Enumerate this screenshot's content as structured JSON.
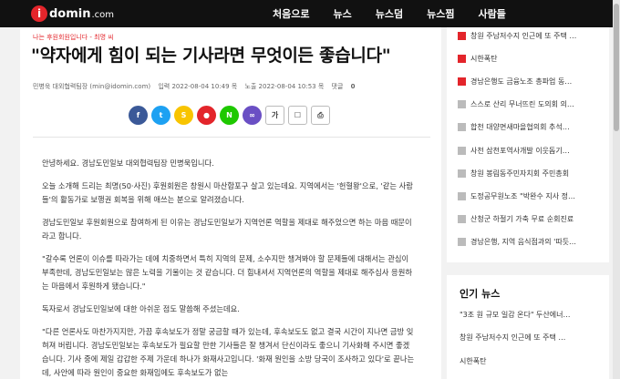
{
  "header": {
    "logo_mark": "i",
    "logo_text": "domin",
    "logo_suffix": ".com",
    "nav": [
      "처음으로",
      "뉴스",
      "뉴스덤",
      "뉴스찜",
      "사람들"
    ]
  },
  "article": {
    "kicker": "나는 후원회원입니다 - 최명 씨",
    "headline": "\"약자에게 힘이 되는 기사라면 무엇이든 좋습니다\"",
    "meta": {
      "author": "민병욱 대외협력팀장 (min@idomin.com)",
      "published": "입력 2022-08-04 10:49 목",
      "updated": "노출 2022-08-04 10:53 목",
      "comments_label": "댓글",
      "comments_count": "0"
    },
    "share_buttons": [
      {
        "name": "facebook-share-icon",
        "glyph": "f",
        "color": "#3b5998"
      },
      {
        "name": "twitter-share-icon",
        "glyph": "t",
        "color": "#1da1f2"
      },
      {
        "name": "kakaostory-share-icon",
        "glyph": "S",
        "color": "#f8c400"
      },
      {
        "name": "kakaotalk-share-icon",
        "glyph": "●",
        "color": "#e3252b"
      },
      {
        "name": "naver-share-icon",
        "glyph": "N",
        "color": "#1ec800"
      },
      {
        "name": "link-share-icon",
        "glyph": "∞",
        "color": "#6a4fc4"
      },
      {
        "name": "font-size-icon",
        "glyph": "가",
        "color": "#ffffff"
      },
      {
        "name": "bookmark-icon",
        "glyph": "☐",
        "color": "#ffffff"
      },
      {
        "name": "print-icon",
        "glyph": "⎙",
        "color": "#ffffff"
      }
    ],
    "paragraphs": [
      "안녕하세요. 경남도민일보 대외협력팀장 민병욱입니다.",
      "오늘 소개해 드리는 최명(50·사진) 후원회원은 창원시 마산합포구 살고 있는데요. 지역에서는 '헌혈왕'으로, '같는 사람들'의 활동가로 보행권 회복을 위해 애쓰는 분으로 알려졌습니다.",
      "경남도민일보 후원회원으로 참여하게 된 이유는 경남도민일보가 지역언론 역할을 제대로 해주었으면 하는 마음 때문이라고 합니다.",
      "\"갈수록 언론이 이슈를 따라가는 데에 치중하면서 특히 지역의 문제, 소수지만 챙겨봐야 할 문제들에 대해서는 관심이 부족한데, 경남도민일보는 많은 노력을 기울이는 것 같습니다. 더 힘내셔서 지역언론의 역할을 제대로 해주십사 응원하는 마음에서 후원하게 됐습니다.\"",
      "독자로서 경남도민일보에 대한 아쉬운 점도 말씀해 주셨는데요.",
      "\"다른 언론사도 마찬가지지만, 가끔 후속보도가 정말 궁금할 때가 있는데, 후속보도도 없고 결국 시간이 지나면 금방 잊혀져 버립니다. 경남도민일보는 후속보도가 필요할 만한 기사들은 잘 챙겨서 단신이라도 좋으니 기사화해 주시면 좋겠습니다. 기사 중에 제일 갑갑한 주제 가운데 하나가 화재사고입니다. '화재 원인을 소방 당국이 조사하고 있다'로 끝나는데, 사안에 따라 원인이 중요한 화재임에도 후속보도가 없는"
    ]
  },
  "sidebar": {
    "ranking": [
      {
        "num": "",
        "text": "창원 주남저수지 인근에 또 주택 …"
      },
      {
        "num": "",
        "text": "시한폭탄"
      },
      {
        "num": "",
        "text": "경남은행도 금융노조 총파업 동…"
      },
      {
        "num": "",
        "text": "스스로 산리 무너뜨린 도의회 의…"
      },
      {
        "num": "",
        "text": "합천 대양면새마을협의회 추석…"
      },
      {
        "num": "",
        "text": "사천 삼천포역사개발 이웃돕기…"
      },
      {
        "num": "",
        "text": "창원 봉림동주민자치회 주민총회"
      },
      {
        "num": "",
        "text": "도정공무원노조 \"박완수 지사 정…"
      },
      {
        "num": "",
        "text": "산청군 하절기 가축 무료 순회진료"
      },
      {
        "num": "",
        "text": "경남은행, 지역 음식점과의 '따듯…"
      }
    ],
    "popular_title": "인기 뉴스",
    "popular": [
      "\"3조 원 규모 일감 온다\" 두산에너…",
      "창원 주남저수지 인근에 또 주택 …",
      "시한폭탄"
    ]
  },
  "colors": {
    "accent": "#e3252b",
    "rank_muted": "#bbbbbb"
  }
}
